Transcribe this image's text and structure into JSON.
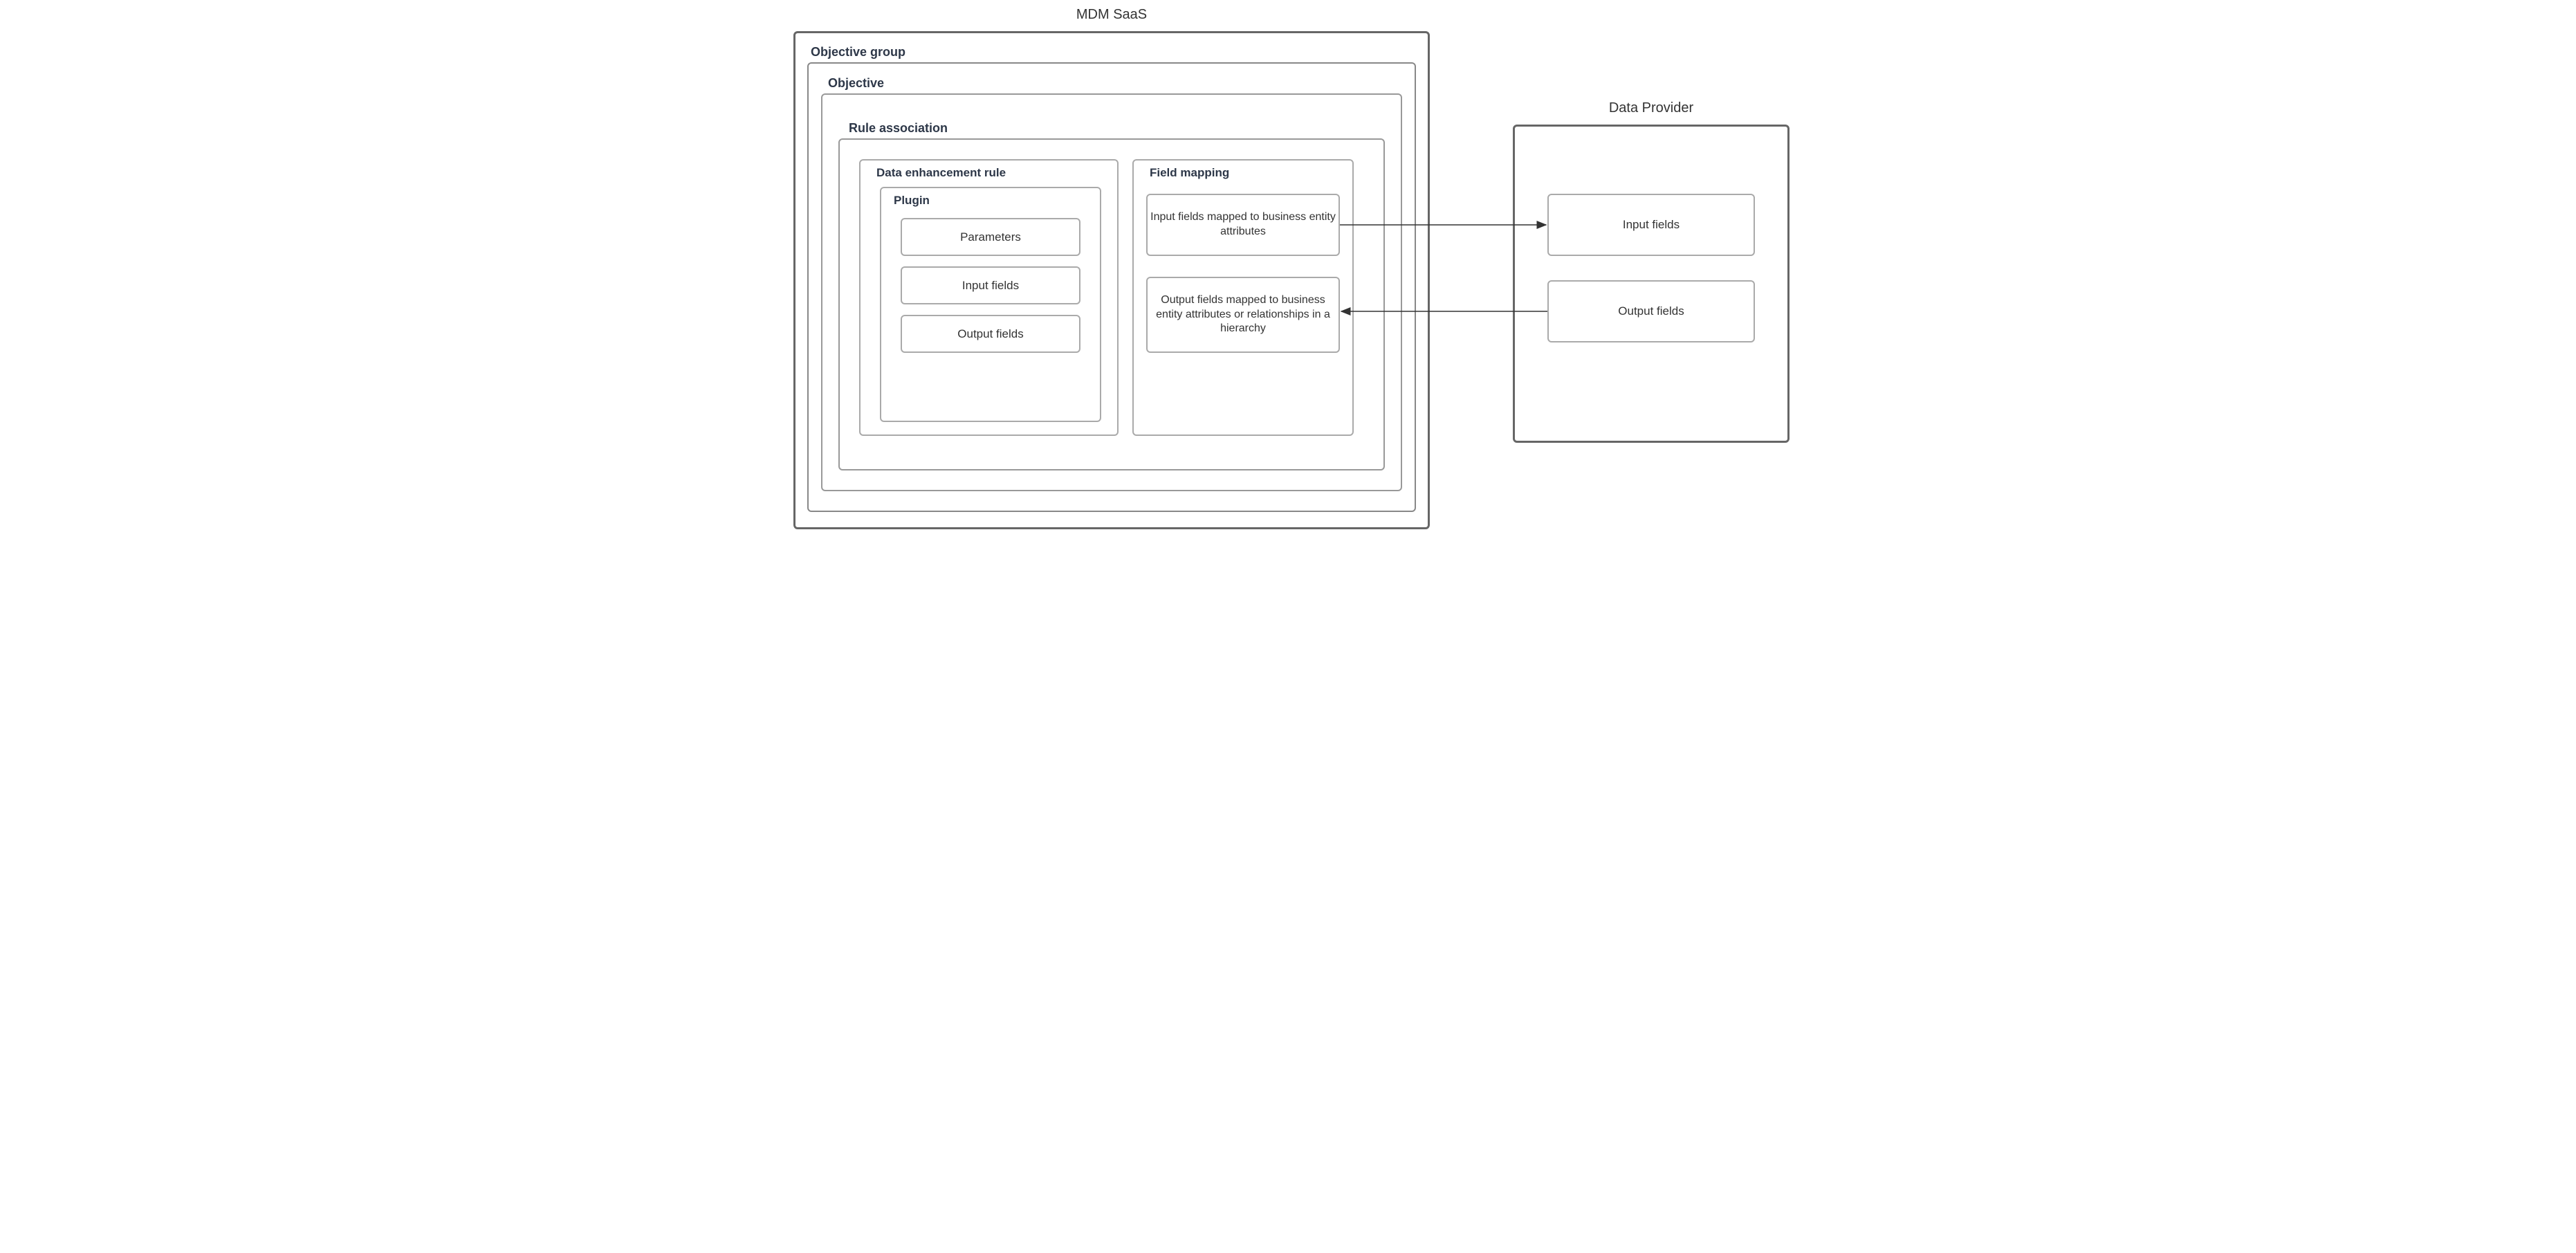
{
  "mdm": {
    "title": "MDM SaaS",
    "objective_group": {
      "title": "Objective group",
      "objective": {
        "title": "Objective",
        "rule_association": {
          "title": "Rule association",
          "enhancement_rule": {
            "title": "Data enhancement rule",
            "plugin": {
              "title": "Plugin",
              "parameters": "Parameters",
              "input_fields": "Input fields",
              "output_fields": "Output fields"
            }
          },
          "field_mapping": {
            "title": "Field mapping",
            "input_mapped": "Input fields mapped to business entity attributes",
            "output_mapped": "Output fields mapped to business entity attributes or relationships in a hierarchy"
          }
        }
      }
    }
  },
  "data_provider": {
    "title": "Data Provider",
    "input_fields": "Input fields",
    "output_fields": "Output fields"
  }
}
